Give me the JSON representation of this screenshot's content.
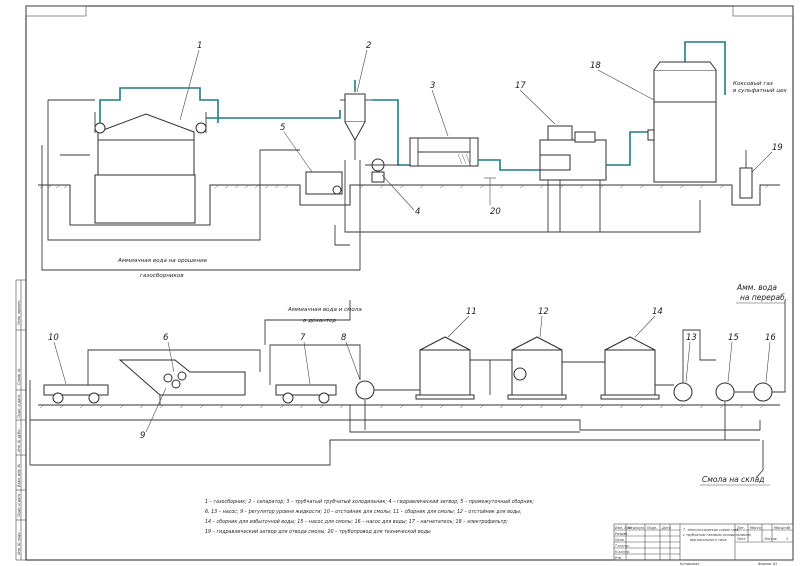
{
  "numbers": {
    "n1": "1",
    "n2": "2",
    "n3": "3",
    "n4": "4",
    "n5": "5",
    "n6": "6",
    "n7": "7",
    "n8": "8",
    "n9": "9",
    "n10": "10",
    "n11": "11",
    "n12": "12",
    "n13": "13",
    "n14": "14",
    "n15": "15",
    "n16": "16",
    "n17": "17",
    "n18": "18",
    "n19": "19",
    "n20": "20"
  },
  "labels": {
    "coke_gas_line1": "Коксовый газ",
    "coke_gas_line2": "в сульфатный цех",
    "ammonia_water_line1": "Аммиачная вода на орошение",
    "ammonia_water_line2": "газосборников",
    "ammonia_water_tar_line1": "Аммиачная вода и смола",
    "ammonia_water_tar_line2": "в декантер",
    "amm_water_proc_line1": "Амм. вода",
    "amm_water_proc_line2": "на перераб.",
    "tar_to_storage": "Смола на склад"
  },
  "legend": {
    "line1": "1 – газосборник; 2 – сепаратор; 3 – трубчатый трубчатый холодильник; 4 – гидравлический затвор; 5 – промежуточный сборник;",
    "line2": "6, 13 – насос; 9 – регулятор уровня жидкости; 10 – отстойник для смолы; 11 – сборник для смолы; 12 – отстойник для воды;",
    "line3": "14 – сборник для избыточной воды; 15 – насос для смолы; 16 – насос для воды; 17 – нагнетатель; 18 – электрофильтр;",
    "line4": "19 – гидравлический затвор для отвода смолы; 20 – трубопровод для технической воды"
  },
  "title_block": {
    "title_line1": "Т. технологическая схема газа",
    "title_line2": "с трубчатым газовым холодильником",
    "title_line3": "вертикального типа",
    "copied": "Копировал",
    "format": "Формат А1",
    "col_lit": "Лит.",
    "col_mass": "Масса",
    "col_scale": "Масштаб",
    "sheet": "Лист",
    "sheets": "Листов",
    "sheets_count": "1",
    "row_change": "Изм. Лист",
    "row_doc": "№ докум.",
    "row_sign": "Подп.",
    "row_date": "Дата",
    "row_dev": "Разраб.",
    "row_check": "Пров.",
    "row_tcontr": "Т.контр.",
    "row_ncontr": "Н.контр.",
    "row_appr": "Утв."
  },
  "side_strip": {
    "s1": "Перв. примен.",
    "s2": "Справ. №",
    "s3": "Подп. и дата",
    "s4": "Инв. № дубл.",
    "s5": "Взам. инв. №",
    "s6": "Подп. и дата",
    "s7": "Инв. № подл."
  },
  "colors": {
    "gas_line": "#1d7d80",
    "line": "#3a3a3a"
  }
}
